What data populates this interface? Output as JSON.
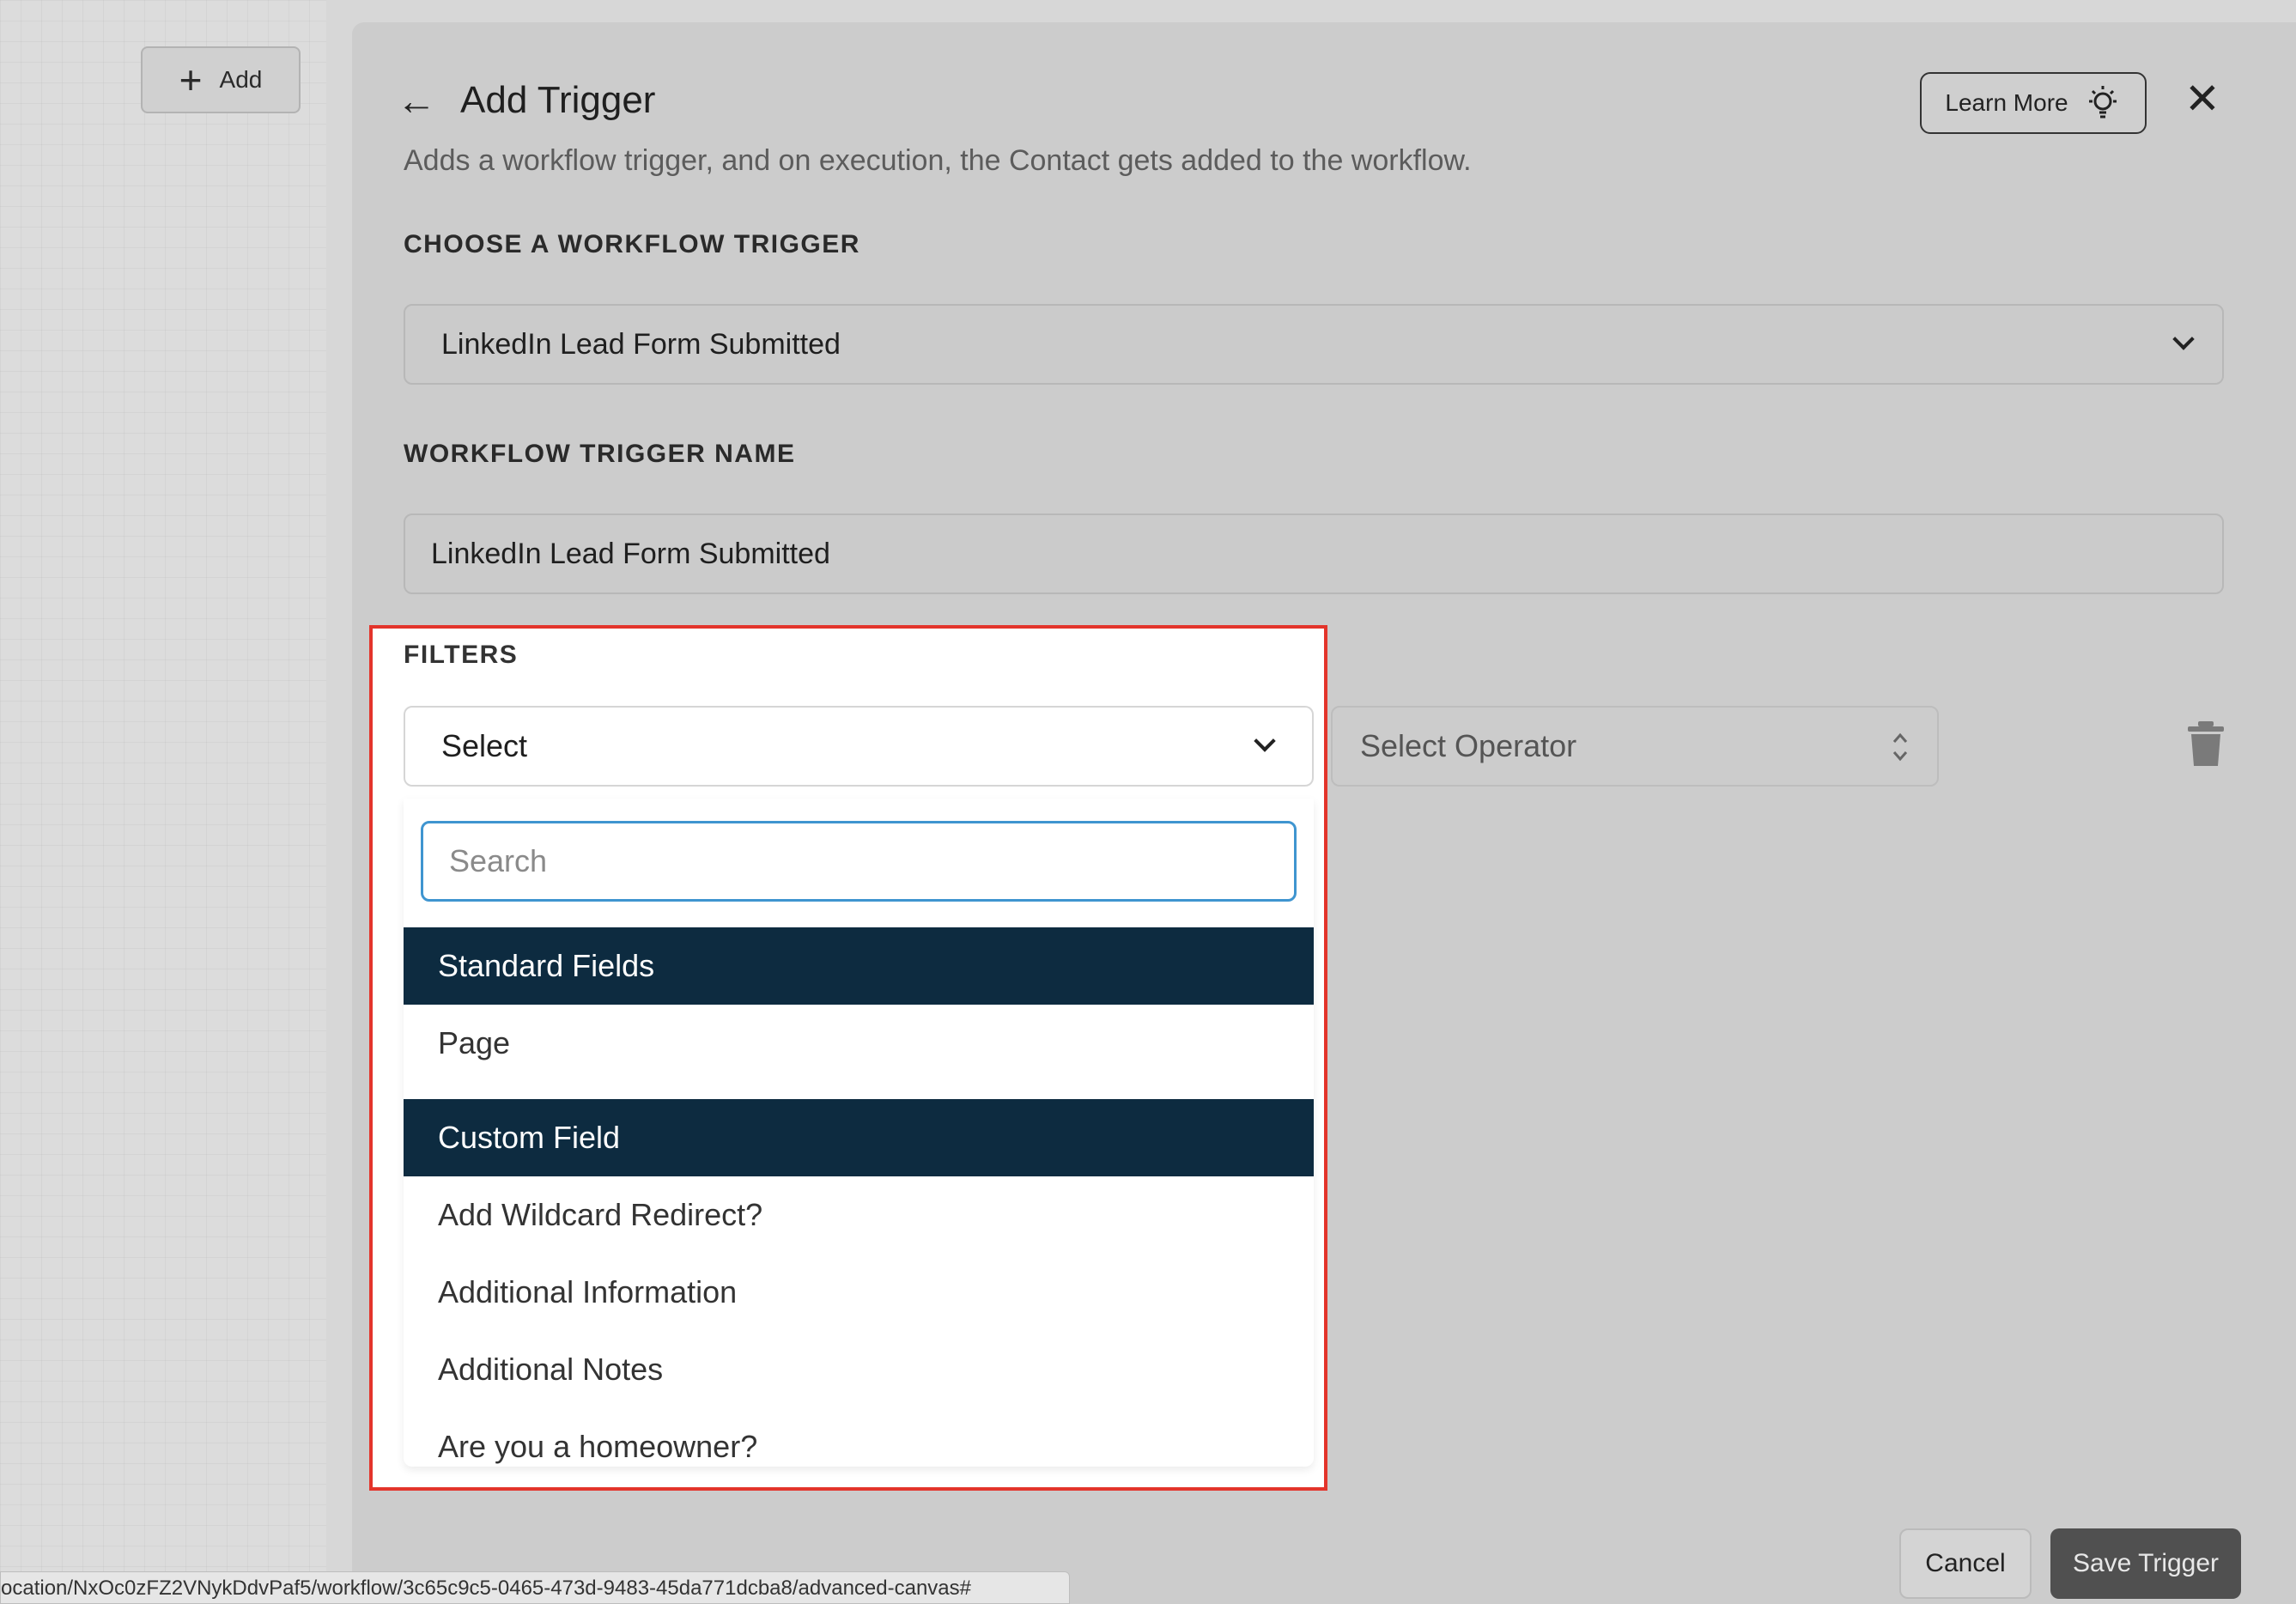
{
  "canvas": {
    "add_label": "Add"
  },
  "header": {
    "title": "Add Trigger",
    "subtitle": "Adds a workflow trigger, and on execution, the Contact gets added to the workflow.",
    "learn_more_label": "Learn More"
  },
  "trigger": {
    "section_label": "CHOOSE A WORKFLOW TRIGGER",
    "selected": "LinkedIn Lead Form Submitted"
  },
  "trigger_name": {
    "section_label": "WORKFLOW TRIGGER NAME",
    "value": "LinkedIn Lead Form Submitted"
  },
  "filters": {
    "section_label": "FILTERS",
    "field_select_value": "Select",
    "search_placeholder": "Search",
    "groups": [
      {
        "header": "Standard Fields",
        "options": [
          "Page"
        ]
      },
      {
        "header": "Custom Field",
        "options": [
          "Add Wildcard Redirect?",
          "Additional Information",
          "Additional Notes",
          "Are you a homeowner?"
        ]
      }
    ],
    "operator_placeholder": "Select Operator"
  },
  "footer": {
    "cancel_label": "Cancel",
    "save_label": "Save Trigger"
  },
  "status_bar": {
    "url": "ocation/NxOc0zFZ2VNykDdvPaf5/workflow/3c65c9c5-0465-473d-9483-45da771dcba8/advanced-canvas#"
  },
  "colors": {
    "highlight_border": "#e3342b",
    "group_header_bg": "#0d2b40",
    "search_focus": "#3f95d0",
    "save_button_bg": "#505050"
  }
}
